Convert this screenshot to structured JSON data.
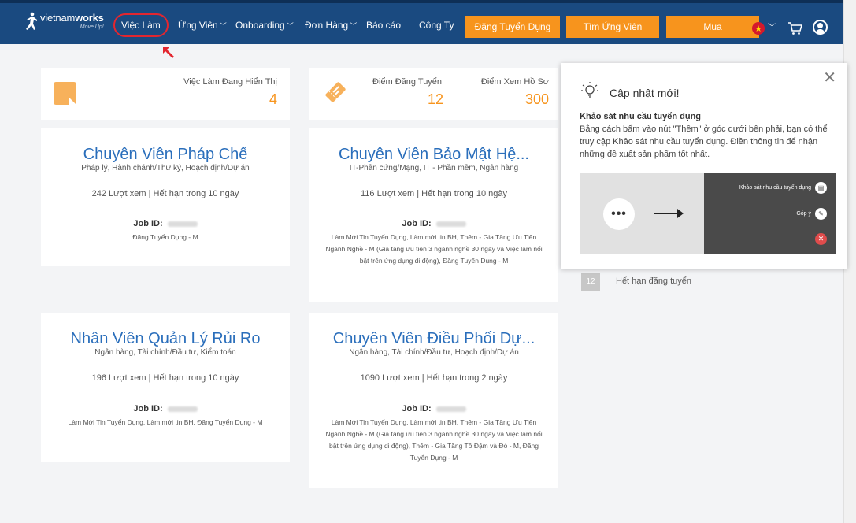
{
  "nav": {
    "logo_name": "vietnam",
    "logo_name_bold": "works",
    "logo_tagline": "Move Up!",
    "items": [
      {
        "label": "Việc Làm",
        "dropdown": false,
        "active": true
      },
      {
        "label": "Ứng Viên",
        "dropdown": true
      },
      {
        "label": "Onboarding",
        "dropdown": true
      },
      {
        "label": "Đơn Hàng",
        "dropdown": true
      },
      {
        "label": "Báo cáo",
        "dropdown": false
      },
      {
        "label": "Công Ty",
        "dropdown": false
      }
    ],
    "buttons": [
      "Đăng Tuyển Dụng",
      "Tìm Ứng Viên",
      "Mua"
    ],
    "accent_color": "#f7941d",
    "bar_color": "#1a4a80"
  },
  "stats": {
    "active_jobs_label": "Việc Làm Đang Hiển Thị",
    "active_jobs_value": "4",
    "posting_points_label": "Điểm Đăng Tuyển",
    "posting_points_value": "12",
    "view_points_label": "Điểm Xem Hồ Sơ",
    "view_points_value": "300"
  },
  "jobs": [
    {
      "title": "Chuyên Viên Pháp Chế",
      "categories": "Pháp lý, Hành chánh/Thư ký, Hoạch định/Dự án",
      "stats": "242 Lượt xem | Hết hạn trong 10 ngày",
      "id_label": "Job ID:",
      "services": "Đăng Tuyển Dụng - M"
    },
    {
      "title": "Chuyên Viên Bảo Mật Hệ...",
      "categories": "IT-Phần cứng/Mạng, IT - Phần mềm, Ngân hàng",
      "stats": "116 Lượt xem | Hết hạn trong 10 ngày",
      "id_label": "Job ID:",
      "services": "Làm Mới Tin Tuyển Dụng, Làm mới tin BH, Thêm - Gia Tăng Ưu Tiên Ngành Nghề - M (Gia tăng ưu tiên 3 ngành nghề 30 ngày và Việc làm nổi bật trên ứng dụng di động), Đăng Tuyển Dụng - M"
    },
    {
      "title": "Nhân Viên Quản Lý Rủi Ro",
      "categories": "Ngân hàng, Tài chính/Đầu tư, Kiểm toán",
      "stats": "196 Lượt xem | Hết hạn trong 10 ngày",
      "id_label": "Job ID:",
      "services": "Làm Mới Tin Tuyển Dụng, Làm mới tin BH, Đăng Tuyển Dụng - M"
    },
    {
      "title": "Chuyên Viên Điều Phối Dự...",
      "categories": "Ngân hàng, Tài chính/Đầu tư, Hoạch định/Dự án",
      "stats": "1090 Lượt xem | Hết hạn trong 2 ngày",
      "id_label": "Job ID:",
      "services": "Làm Mới Tin Tuyển Dụng, Làm mới tin BH, Thêm - Gia Tăng Ưu Tiên Ngành Nghề - M (Gia tăng ưu tiên 3 ngành nghề 30 ngày và Việc làm nổi bật trên ứng dụng di động), Thêm - Gia Tăng Tô Đậm và Đỏ - M, Đăng Tuyển Dụng - M"
    }
  ],
  "popup": {
    "title": "Cập nhật mới!",
    "heading": "Khảo sát nhu cầu tuyển dụng",
    "body": "Bằng cách bấm vào nút \"Thêm\" ở góc dưới bên phải, bạn có thể truy cập Khảo sát nhu cầu tuyển dụng. Điền thông tin để nhận những đề xuất sản phẩm tốt nhất.",
    "demo_survey_label": "Khảo sát nhu cầu tuyển dụng",
    "demo_feedback_label": "Góp ý",
    "demo_dots": "•••"
  },
  "expired": {
    "count": "12",
    "label": "Hết hạn đăng tuyển"
  }
}
